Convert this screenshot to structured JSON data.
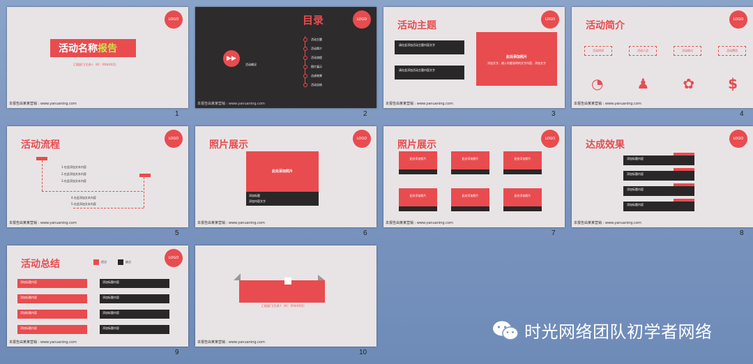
{
  "slides": [
    {
      "number": "1",
      "title": "活动名称",
      "title_accent": "报告",
      "subtitle": "汇报部门/主讲人（时：XX年XX月）",
      "logo": "LOGO",
      "footer": "本报告由某某营销 : www.yanuaning.com"
    },
    {
      "number": "2",
      "title": "目录",
      "logo": "LOGO",
      "center_label": "活动概况",
      "toc_items": [
        "活动主题",
        "活动简介",
        "活动流程",
        "照片展示",
        "达成效果",
        "活动总结"
      ],
      "footer": "本报告由某某营销 : www.yanuaning.com"
    },
    {
      "number": "3",
      "title": "活动主题",
      "logo": "LOGO",
      "photo_label": "此处添加照片",
      "photo_sub": "添加文字，输入你要说明的文字内容，添加文字",
      "bars": [
        "请在此添加活动主题内容文字",
        "请在此添加活动主题内容文字"
      ],
      "footer": "本报告由某某营销 : www.yanuaning.com"
    },
    {
      "number": "4",
      "title": "活动简介",
      "logo": "LOGO",
      "bubbles": [
        "活动时间",
        "活动人员",
        "活动地点",
        "活动费用"
      ],
      "footer": "本报告由某某营销 : www.yanuaning.com"
    },
    {
      "number": "5",
      "title": "活动流程",
      "logo": "LOGO",
      "steps": [
        "1.在此添加文本内容",
        "2.在此添加文本内容",
        "3.在此添加文本内容",
        "4.在此添加文本内容",
        "5.在此添加文本内容"
      ],
      "footer": "本报告由某某营销 : www.yanuaning.com"
    },
    {
      "number": "6",
      "title": "照片展示",
      "logo": "LOGO",
      "photo_label": "此处添加照片",
      "caption1": "添加标题",
      "caption2": "添加内容文字",
      "footer": "本报告由某某营销 : www.yanuaning.com"
    },
    {
      "number": "7",
      "title": "照片展示",
      "logo": "LOGO",
      "photo_label": "此处添加照片",
      "footer": "本报告由某某营销 : www.yanuaning.com"
    },
    {
      "number": "8",
      "title": "达成效果",
      "logo": "LOGO",
      "bar_label": "添加标题内容",
      "footer": "本报告由某某营销 : www.yanuaning.com"
    },
    {
      "number": "9",
      "title": "活动总结",
      "logo": "LOGO",
      "legend": [
        "优点",
        "缺点"
      ],
      "bar_label": "添加标题内容",
      "footer": "本报告由某某营销 : www.yanuaning.com"
    },
    {
      "number": "10",
      "subtitle": "汇报部门/主讲人（时：XX年XX月）",
      "footer": "本报告由某某营销 : www.yanuaning.com"
    }
  ],
  "watermark": {
    "text": "时光网络团队初学者网络",
    "icon": "wechat-icon"
  },
  "colors": {
    "accent": "#e84c4f",
    "dark": "#2a2728",
    "slide_bg": "#e8e4e6"
  }
}
